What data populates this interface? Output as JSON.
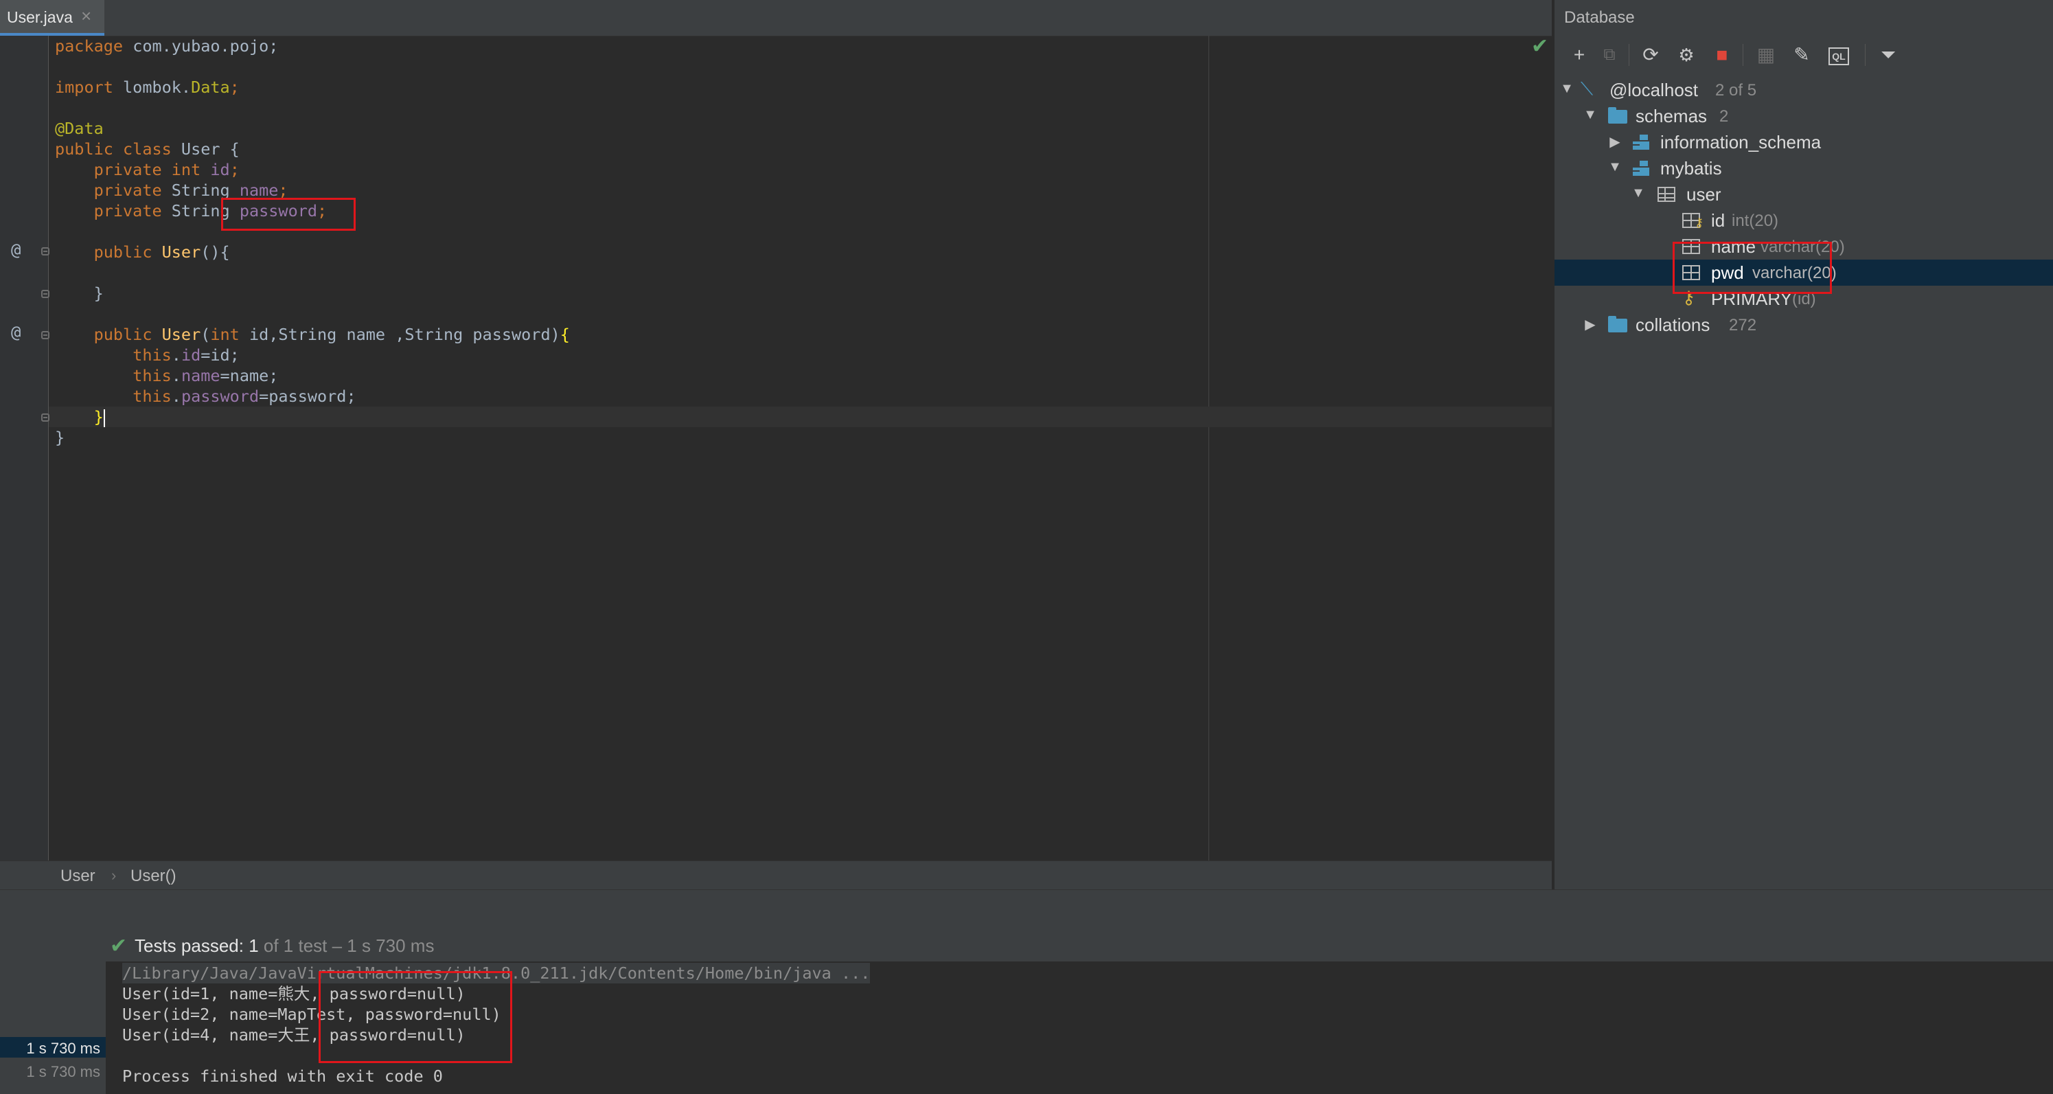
{
  "editor": {
    "tab": {
      "label": "User.java",
      "close": "×"
    },
    "code_lines": {
      "l1_kw": "package",
      "l1_rest": " com.yubao.pojo;",
      "l3_kw": "import",
      "l3_rest_a": " lombok.",
      "l3_rest_b": "Data",
      "l3_rest_c": ";",
      "l5_an": "@Data",
      "l6_kw": "public class",
      "l6_rest": " User {",
      "l7_kw": "private int",
      "l7_fd": "id",
      "l8_kw": "private",
      "l8_type": " String ",
      "l8_fd": "name",
      "l9_kw": "private",
      "l9_type": " String ",
      "l9_fd": "password",
      "semi": ";",
      "l11_kw": "public",
      "l11_mt": "User",
      "l11_rest": "(){",
      "l13_rest": "}",
      "l15_kw": "public",
      "l15_mt": "User",
      "l15_p1": "(",
      "l15_kw2": "int",
      "l15_p2": " id,String name ,String password)",
      "l15_br": "{",
      "this_kw": "this",
      "dot": ".",
      "l16_fd": "id",
      "l16_rest": "=id;",
      "l17_fd": "name",
      "l17_rest": "=name;",
      "l18_fd": "password",
      "l18_rest": "=password;",
      "l19_br": "}",
      "l20_rest": "}"
    },
    "gutter_at": "@",
    "check_icon": "✔"
  },
  "breadcrumb": {
    "item1": "User",
    "sep": "›",
    "item2": "User()"
  },
  "database": {
    "title": "Database",
    "toolbar": {
      "add": "+",
      "copy": "⧉",
      "refresh": "⟳",
      "sync": "⚙",
      "stop": "■",
      "table": "▦",
      "edit": "✎",
      "console": "QL",
      "filter": "⏷"
    },
    "tree": {
      "host": {
        "name": "@localhost",
        "meta": "2 of 5"
      },
      "schemas": {
        "name": "schemas",
        "meta": "2"
      },
      "info_schema": {
        "name": "information_schema"
      },
      "mybatis": {
        "name": "mybatis"
      },
      "user_table": {
        "name": "user"
      },
      "col_id": {
        "name": "id",
        "meta": "int(20)"
      },
      "col_name": {
        "name": "name",
        "meta": "varchar(20)"
      },
      "col_pwd": {
        "name": "pwd",
        "meta": "varchar(20)"
      },
      "primary": {
        "name": "PRIMARY",
        "meta": "(id)"
      },
      "collations": {
        "name": "collations",
        "meta": "272"
      }
    }
  },
  "run": {
    "status_bold": "Tests passed:",
    "status_count": " 1",
    "status_rest": " of 1 test – 1 s 730 ms",
    "times": [
      "1 s 730 ms",
      "1 s 730 ms"
    ],
    "output": [
      "/Library/Java/JavaVirtualMachines/jdk1.8.0_211.jdk/Contents/Home/bin/java ...",
      "User(id=1, name=熊大, password=null)",
      "User(id=2, name=MapTest, password=null)",
      "User(id=4, name=大王, password=null)",
      "",
      "Process finished with exit code 0"
    ]
  },
  "colors": {
    "highlight_box": "#e0161b",
    "editor_bg": "#2b2b2b",
    "panel_bg": "#3c3f41",
    "selection": "#0d293e",
    "keyword": "#cc7832",
    "field": "#9876aa",
    "method": "#ffc66d"
  }
}
